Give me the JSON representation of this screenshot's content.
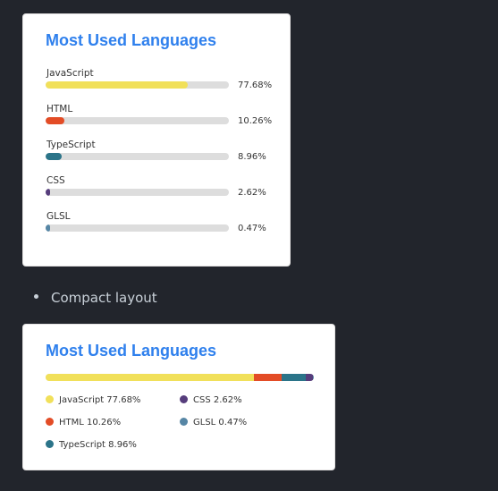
{
  "cards": {
    "normal": {
      "title": "Most Used Languages"
    },
    "compact": {
      "title": "Most Used Languages"
    }
  },
  "languages": [
    {
      "name": "JavaScript",
      "percent": "77.68%",
      "value": 77.68,
      "color": "#f1e05a",
      "legend": "JavaScript 77.68%"
    },
    {
      "name": "HTML",
      "percent": "10.26%",
      "value": 10.26,
      "color": "#e34c26",
      "legend": "HTML 10.26%"
    },
    {
      "name": "TypeScript",
      "percent": "8.96%",
      "value": 8.96,
      "color": "#2b7489",
      "legend": "TypeScript 8.96%"
    },
    {
      "name": "CSS",
      "percent": "2.62%",
      "value": 2.62,
      "color": "#563d7c",
      "legend": "CSS 2.62%"
    },
    {
      "name": "GLSL",
      "percent": "0.47%",
      "value": 0.47,
      "color": "#5686a5",
      "legend": "GLSL 0.47%"
    }
  ],
  "bullet": {
    "text": "Compact layout"
  }
}
